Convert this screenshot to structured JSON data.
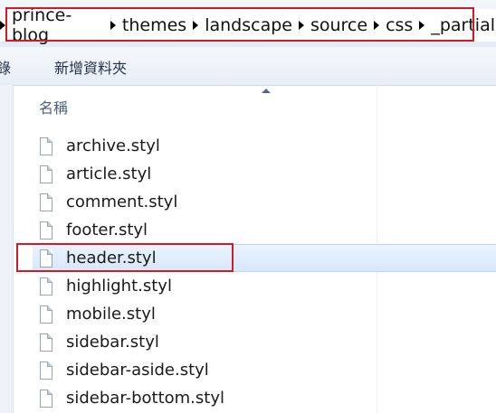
{
  "breadcrumb": [
    "prince-blog",
    "themes",
    "landscape",
    "source",
    "css",
    "_partial"
  ],
  "toolbar": {
    "cut_label": "錄",
    "new_folder_label": "新增資料夾"
  },
  "column_header": "名稱",
  "files": [
    "archive.styl",
    "article.styl",
    "comment.styl",
    "footer.styl",
    "header.styl",
    "highlight.styl",
    "mobile.styl",
    "sidebar.styl",
    "sidebar-aside.styl",
    "sidebar-bottom.styl"
  ],
  "selected_file": "header.styl",
  "colors": {
    "highlight_box": "#d11a22",
    "selection": "#d6e7fb"
  }
}
